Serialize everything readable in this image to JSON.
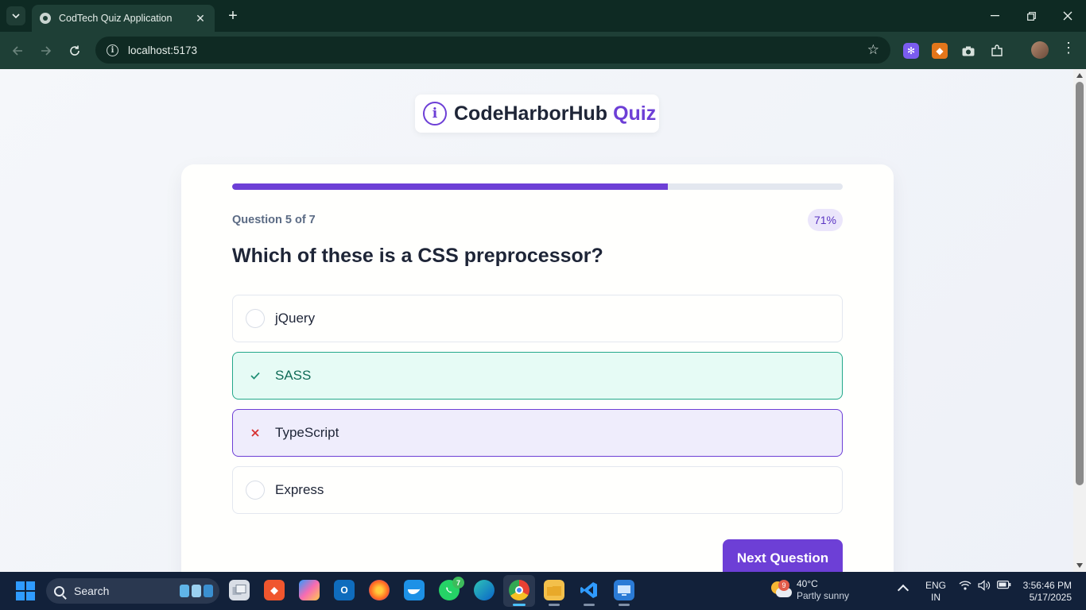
{
  "browser": {
    "tab_title": "CodTech Quiz Application",
    "new_tab_symbol": "+",
    "url": "localhost:5173"
  },
  "page": {
    "brand": {
      "name": "CodeHarborHub",
      "accent": "Quiz",
      "icon": "info-circle-icon"
    },
    "progress": {
      "fraction": 0.714,
      "label": "71%"
    },
    "question_counter": "Question 5 of 7",
    "question": "Which of these is a CSS preprocessor?",
    "options": [
      {
        "label": "jQuery",
        "state": "default"
      },
      {
        "label": "SASS",
        "state": "correct"
      },
      {
        "label": "TypeScript",
        "state": "wrong"
      },
      {
        "label": "Express",
        "state": "default"
      }
    ],
    "next_button": "Next Question",
    "colors": {
      "accent": "#6d3fd6",
      "correct": "#23a88a",
      "wrong": "#d63030"
    }
  },
  "taskbar": {
    "search_label": "Search",
    "badges": {
      "whatsapp": "7"
    },
    "weather": {
      "badge": "9",
      "temp": "40°C",
      "desc": "Partly sunny"
    },
    "lang": {
      "line1": "ENG",
      "line2": "IN"
    },
    "clock": {
      "time": "3:56:46 PM",
      "date": "5/17/2025"
    }
  }
}
